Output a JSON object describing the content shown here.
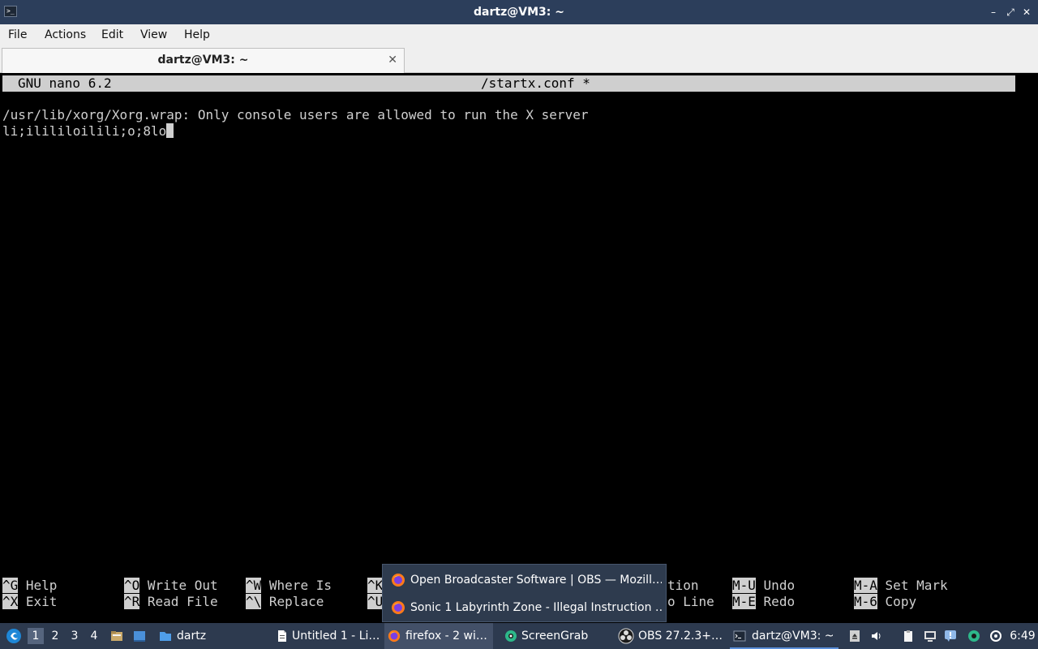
{
  "window": {
    "title": "dartz@VM3: ~",
    "controls": {
      "minimize": "–",
      "maximize": "⤢",
      "close": "✕"
    }
  },
  "menu": [
    "File",
    "Actions",
    "Edit",
    "View",
    "Help"
  ],
  "tab": {
    "label": "dartz@VM3: ~",
    "close": "✕"
  },
  "nano": {
    "version": "GNU nano 6.2",
    "filename": "/startx.conf *",
    "lines": [
      "/usr/lib/xorg/Xorg.wrap: Only console users are allowed to run the X server",
      "li;ilililoilili;o;8lo"
    ],
    "shortcuts_row1": [
      {
        "key": "^G",
        "label": "Help"
      },
      {
        "key": "^O",
        "label": "Write Out"
      },
      {
        "key": "^W",
        "label": "Where Is"
      },
      {
        "key": "^K",
        "label": ""
      },
      {
        "key": "",
        "label": "tion"
      },
      {
        "key": "M-U",
        "label": "Undo"
      },
      {
        "key": "M-A",
        "label": "Set Mark"
      }
    ],
    "shortcuts_row2": [
      {
        "key": "^X",
        "label": "Exit"
      },
      {
        "key": "^R",
        "label": "Read File"
      },
      {
        "key": "^\\",
        "label": "Replace"
      },
      {
        "key": "^U",
        "label": ""
      },
      {
        "key": "",
        "label": "o Line"
      },
      {
        "key": "M-E",
        "label": "Redo"
      },
      {
        "key": "M-6",
        "label": "Copy"
      }
    ]
  },
  "popup": {
    "items": [
      "Open Broadcaster Software | OBS — Mozill…",
      "Sonic 1 Labyrinth Zone - Illegal Instruction …"
    ]
  },
  "taskbar": {
    "workspaces": [
      "1",
      "2",
      "3",
      "4"
    ],
    "folder_label": "dartz",
    "tasks": [
      {
        "label": "Untitled 1 - Li…",
        "icon": "document-icon"
      },
      {
        "label": "firefox - 2 wi…",
        "icon": "firefox-icon"
      },
      {
        "label": "ScreenGrab",
        "icon": "screengrab-icon"
      },
      {
        "label": "OBS 27.2.3+…",
        "icon": "obs-icon"
      },
      {
        "label": "dartz@VM3: ~",
        "icon": "terminal-icon"
      }
    ],
    "clock": "6:49"
  },
  "colors": {
    "titlebar": "#2c3e5b",
    "taskbar": "#2d3a4f",
    "terminal_bg": "#000000",
    "terminal_fg": "#d0d0d0",
    "nano_bar": "#cfcfcf"
  }
}
